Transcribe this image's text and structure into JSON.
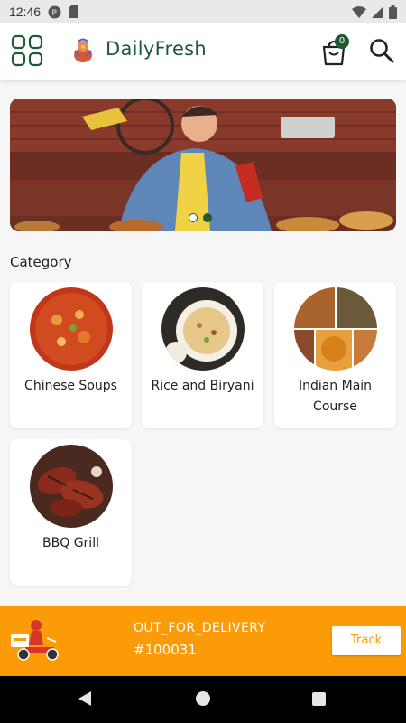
{
  "status_bar": {
    "time": "12:46"
  },
  "app_bar": {
    "title": "DailyFresh",
    "cart_count": "0"
  },
  "banner": {
    "slide_count": 2,
    "active_slide": 2
  },
  "category": {
    "title": "Category",
    "items": [
      {
        "label": "Chinese Soups"
      },
      {
        "label": "Rice and Biryani"
      },
      {
        "label": "Indian Main Course"
      },
      {
        "label": "BBQ Grill"
      }
    ]
  },
  "delivery": {
    "status": "OUT_FOR_DELIVERY",
    "order_id": "#100031",
    "track_label": "Track"
  },
  "colors": {
    "brand": "#1d5a35",
    "accent": "#fb9b07"
  },
  "icons": [
    "grid-menu-icon",
    "app-logo-icon",
    "cart-icon",
    "search-icon",
    "scooter-icon",
    "back-icon",
    "home-icon",
    "recents-icon"
  ]
}
